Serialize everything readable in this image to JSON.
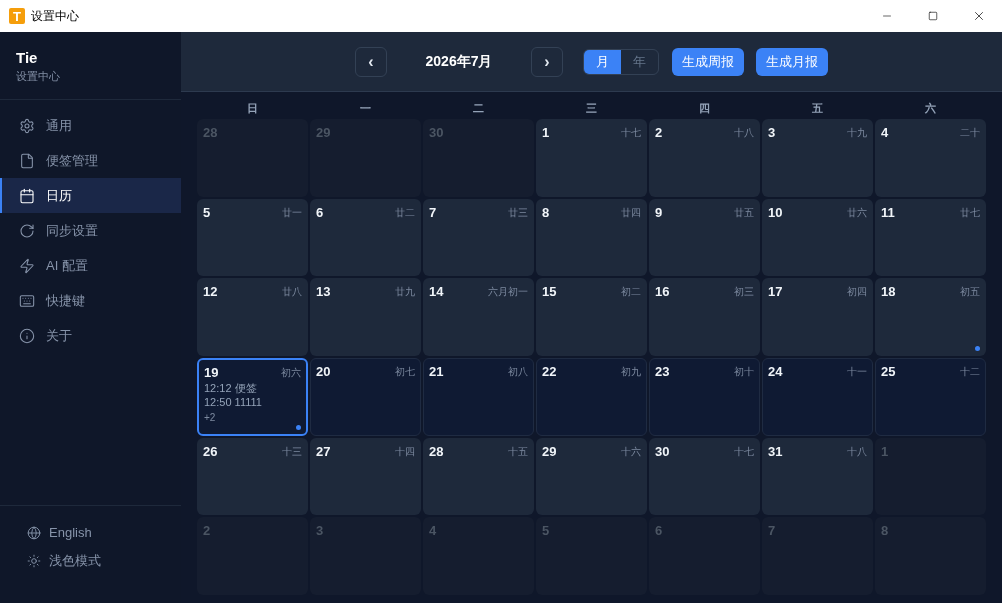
{
  "window": {
    "logo_text": "T",
    "title": "设置中心"
  },
  "sidebar": {
    "brand": "Tie",
    "subtitle": "设置中心",
    "items": [
      {
        "label": "通用",
        "selected": false
      },
      {
        "label": "便签管理",
        "selected": false
      },
      {
        "label": "日历",
        "selected": true
      },
      {
        "label": "同步设置",
        "selected": false
      },
      {
        "label": "AI 配置",
        "selected": false
      },
      {
        "label": "快捷键",
        "selected": false
      },
      {
        "label": "关于",
        "selected": false
      }
    ],
    "footer": [
      {
        "label": "English"
      },
      {
        "label": "浅色模式"
      }
    ]
  },
  "toolbar": {
    "prev": "‹",
    "title": "2026年7月",
    "next": "›",
    "view_modes": [
      {
        "label": "月",
        "selected": true
      },
      {
        "label": "年",
        "selected": false
      }
    ],
    "actions": [
      "生成周报",
      "生成月报"
    ]
  },
  "calendar": {
    "weekdays": [
      "日",
      "一",
      "二",
      "三",
      "四",
      "五",
      "六"
    ],
    "weeks": [
      {
        "current": false,
        "days": [
          {
            "day": "28",
            "in_month": false,
            "selected": false,
            "dot": false
          },
          {
            "day": "29",
            "in_month": false,
            "selected": false,
            "dot": false
          },
          {
            "day": "30",
            "in_month": false,
            "selected": false,
            "dot": false
          },
          {
            "day": "1",
            "lunar": "十七",
            "in_month": true,
            "selected": false,
            "dot": false
          },
          {
            "day": "2",
            "lunar": "十八",
            "in_month": true,
            "selected": false,
            "dot": false
          },
          {
            "day": "3",
            "lunar": "十九",
            "in_month": true,
            "selected": false,
            "dot": false
          },
          {
            "day": "4",
            "lunar": "二十",
            "in_month": true,
            "selected": false,
            "dot": false
          }
        ]
      },
      {
        "current": false,
        "days": [
          {
            "day": "5",
            "lunar": "廿一",
            "in_month": true,
            "selected": false,
            "dot": false
          },
          {
            "day": "6",
            "lunar": "廿二",
            "in_month": true,
            "selected": false,
            "dot": false
          },
          {
            "day": "7",
            "lunar": "廿三",
            "in_month": true,
            "selected": false,
            "dot": false
          },
          {
            "day": "8",
            "lunar": "廿四",
            "in_month": true,
            "selected": false,
            "dot": false
          },
          {
            "day": "9",
            "lunar": "廿五",
            "in_month": true,
            "selected": false,
            "dot": false
          },
          {
            "day": "10",
            "lunar": "廿六",
            "in_month": true,
            "selected": false,
            "dot": false
          },
          {
            "day": "11",
            "lunar": "廿七",
            "in_month": true,
            "selected": false,
            "dot": false
          }
        ]
      },
      {
        "current": false,
        "days": [
          {
            "day": "12",
            "lunar": "廿八",
            "in_month": true,
            "selected": false,
            "dot": false
          },
          {
            "day": "13",
            "lunar": "廿九",
            "in_month": true,
            "selected": false,
            "dot": false
          },
          {
            "day": "14",
            "lunar": "六月初一",
            "in_month": true,
            "selected": false,
            "dot": false
          },
          {
            "day": "15",
            "lunar": "初二",
            "in_month": true,
            "selected": false,
            "dot": false
          },
          {
            "day": "16",
            "lunar": "初三",
            "in_month": true,
            "selected": false,
            "dot": false
          },
          {
            "day": "17",
            "lunar": "初四",
            "in_month": true,
            "selected": false,
            "dot": false
          },
          {
            "day": "18",
            "lunar": "初五",
            "in_month": true,
            "selected": false,
            "dot": true
          }
        ]
      },
      {
        "current": true,
        "days": [
          {
            "day": "19",
            "lunar": "初六",
            "in_month": true,
            "selected": true,
            "dot": true,
            "events": [
              "12:12 便签",
              "12:50 11111"
            ],
            "more": "+2"
          },
          {
            "day": "20",
            "lunar": "初七",
            "in_month": true,
            "selected": false,
            "dot": false
          },
          {
            "day": "21",
            "lunar": "初八",
            "in_month": true,
            "selected": false,
            "dot": false
          },
          {
            "day": "22",
            "lunar": "初九",
            "in_month": true,
            "selected": false,
            "dot": false
          },
          {
            "day": "23",
            "lunar": "初十",
            "in_month": true,
            "selected": false,
            "dot": false
          },
          {
            "day": "24",
            "lunar": "十一",
            "in_month": true,
            "selected": false,
            "dot": false
          },
          {
            "day": "25",
            "lunar": "十二",
            "in_month": true,
            "selected": false,
            "dot": false
          }
        ]
      },
      {
        "current": false,
        "days": [
          {
            "day": "26",
            "lunar": "十三",
            "in_month": true,
            "selected": false,
            "dot": false
          },
          {
            "day": "27",
            "lunar": "十四",
            "in_month": true,
            "selected": false,
            "dot": false
          },
          {
            "day": "28",
            "lunar": "十五",
            "in_month": true,
            "selected": false,
            "dot": false
          },
          {
            "day": "29",
            "lunar": "十六",
            "in_month": true,
            "selected": false,
            "dot": false
          },
          {
            "day": "30",
            "lunar": "十七",
            "in_month": true,
            "selected": false,
            "dot": false
          },
          {
            "day": "31",
            "lunar": "十八",
            "in_month": true,
            "selected": false,
            "dot": false
          },
          {
            "day": "1",
            "in_month": false,
            "selected": false,
            "dot": false
          }
        ]
      },
      {
        "current": false,
        "days": [
          {
            "day": "2",
            "in_month": false,
            "selected": false,
            "dot": false
          },
          {
            "day": "3",
            "in_month": false,
            "selected": false,
            "dot": false
          },
          {
            "day": "4",
            "in_month": false,
            "selected": false,
            "dot": false
          },
          {
            "day": "5",
            "in_month": false,
            "selected": false,
            "dot": false
          },
          {
            "day": "6",
            "in_month": false,
            "selected": false,
            "dot": false
          },
          {
            "day": "7",
            "in_month": false,
            "selected": false,
            "dot": false
          },
          {
            "day": "8",
            "in_month": false,
            "selected": false,
            "dot": false
          }
        ]
      }
    ]
  }
}
